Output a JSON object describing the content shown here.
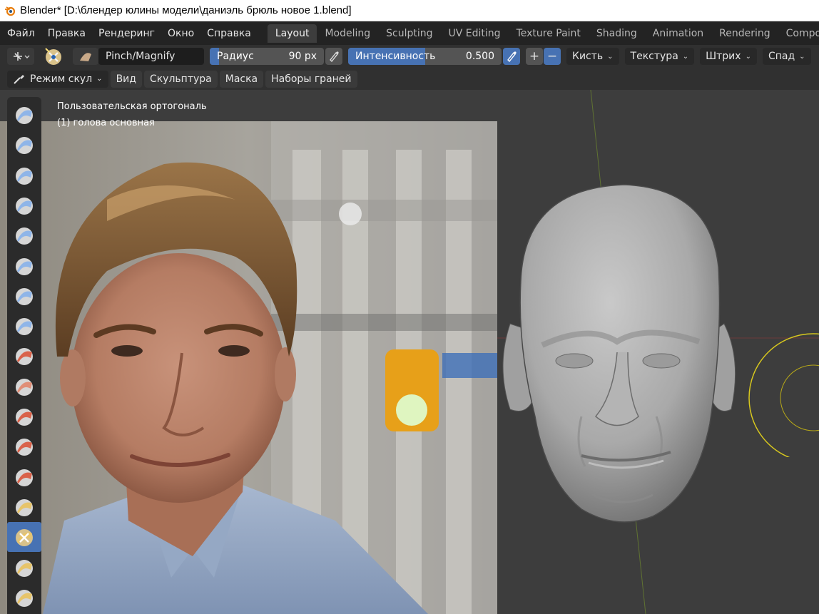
{
  "window": {
    "title": "Blender* [D:\\блендер юлины модели\\даниэль брюль новое 1.blend]"
  },
  "menu": {
    "items": [
      "Файл",
      "Правка",
      "Рендеринг",
      "Окно",
      "Справка"
    ]
  },
  "workspaces": {
    "tabs": [
      "Layout",
      "Modeling",
      "Sculpting",
      "UV Editing",
      "Texture Paint",
      "Shading",
      "Animation",
      "Rendering",
      "Compositing"
    ],
    "active": "Layout"
  },
  "tool_header": {
    "brush_name": "Pinch/Magnify",
    "radius": {
      "label": "Радиус",
      "value": "90 px",
      "fill_fraction": 0.08
    },
    "strength": {
      "label": "Интенсивность",
      "value": "0.500",
      "fill_fraction": 0.5
    },
    "add_symbol": "+",
    "subtract_symbol": "−",
    "dropdowns": [
      "Кисть",
      "Текстура",
      "Штрих",
      "Спад"
    ]
  },
  "mode_header": {
    "mode": "Режим скул",
    "menus": [
      "Вид",
      "Скульптура",
      "Маска",
      "Наборы граней"
    ]
  },
  "viewport": {
    "view_name": "Пользовательская ортогональ",
    "object_name": "(1) голова основная"
  },
  "toolbar": {
    "active_tool": "pinch-magnify",
    "tools": [
      "draw",
      "draw-sharp",
      "clay",
      "clay-strips",
      "clay-thumb",
      "layer",
      "inflate",
      "blob",
      "crease",
      "smooth",
      "flatten",
      "fill",
      "scrape",
      "multiplane-scrape",
      "pinch-magnify",
      "grab",
      "elastic-deform"
    ]
  },
  "colors": {
    "accent": "#4772b3",
    "header_bg": "#303030",
    "topbar_bg": "#232323",
    "viewport_bg": "#3d3d3d",
    "brush_cursor": "#d8c81e"
  }
}
